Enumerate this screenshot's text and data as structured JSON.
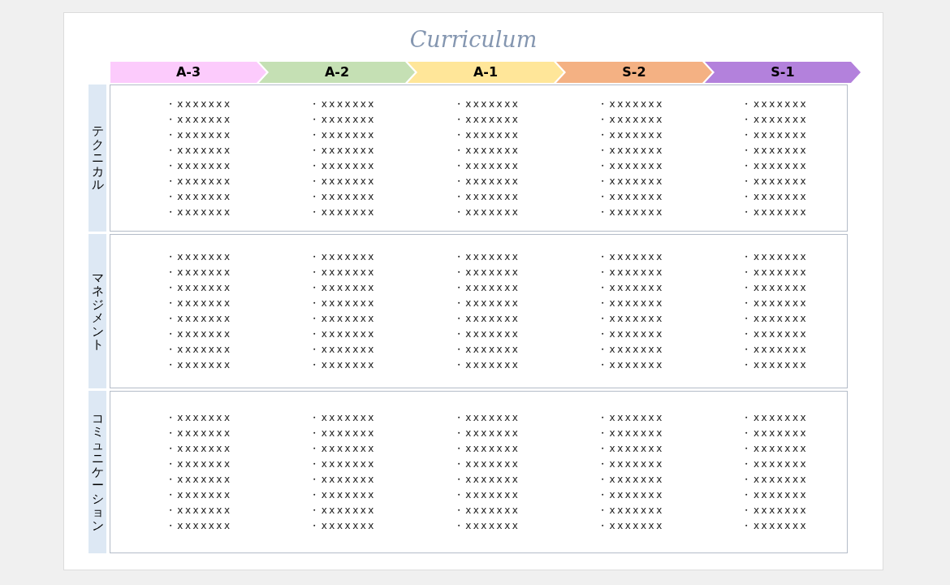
{
  "title": "Curriculum",
  "stages": [
    {
      "label": "A-3",
      "color": "#fccbfc"
    },
    {
      "label": "A-2",
      "color": "#c5e0b4"
    },
    {
      "label": "A-1",
      "color": "#ffe699"
    },
    {
      "label": "S-2",
      "color": "#f4b183"
    },
    {
      "label": "S-1",
      "color": "#b381dc"
    }
  ],
  "rows": [
    {
      "label": "テクニカル",
      "cells": [
        [
          "・xxxxxxx",
          "・xxxxxxx",
          "・xxxxxxx",
          "・xxxxxxx",
          "・xxxxxxx",
          "・xxxxxxx",
          "・xxxxxxx",
          "・xxxxxxx"
        ],
        [
          "・xxxxxxx",
          "・xxxxxxx",
          "・xxxxxxx",
          "・xxxxxxx",
          "・xxxxxxx",
          "・xxxxxxx",
          "・xxxxxxx",
          "・xxxxxxx"
        ],
        [
          "・xxxxxxx",
          "・xxxxxxx",
          "・xxxxxxx",
          "・xxxxxxx",
          "・xxxxxxx",
          "・xxxxxxx",
          "・xxxxxxx",
          "・xxxxxxx"
        ],
        [
          "・xxxxxxx",
          "・xxxxxxx",
          "・xxxxxxx",
          "・xxxxxxx",
          "・xxxxxxx",
          "・xxxxxxx",
          "・xxxxxxx",
          "・xxxxxxx"
        ],
        [
          "・xxxxxxx",
          "・xxxxxxx",
          "・xxxxxxx",
          "・xxxxxxx",
          "・xxxxxxx",
          "・xxxxxxx",
          "・xxxxxxx",
          "・xxxxxxx"
        ]
      ]
    },
    {
      "label": "マネジメント",
      "cells": [
        [
          "・xxxxxxx",
          "・xxxxxxx",
          "・xxxxxxx",
          "・xxxxxxx",
          "・xxxxxxx",
          "・xxxxxxx",
          "・xxxxxxx",
          "・xxxxxxx"
        ],
        [
          "・xxxxxxx",
          "・xxxxxxx",
          "・xxxxxxx",
          "・xxxxxxx",
          "・xxxxxxx",
          "・xxxxxxx",
          "・xxxxxxx",
          "・xxxxxxx"
        ],
        [
          "・xxxxxxx",
          "・xxxxxxx",
          "・xxxxxxx",
          "・xxxxxxx",
          "・xxxxxxx",
          "・xxxxxxx",
          "・xxxxxxx",
          "・xxxxxxx"
        ],
        [
          "・xxxxxxx",
          "・xxxxxxx",
          "・xxxxxxx",
          "・xxxxxxx",
          "・xxxxxxx",
          "・xxxxxxx",
          "・xxxxxxx",
          "・xxxxxxx"
        ],
        [
          "・xxxxxxx",
          "・xxxxxxx",
          "・xxxxxxx",
          "・xxxxxxx",
          "・xxxxxxx",
          "・xxxxxxx",
          "・xxxxxxx",
          "・xxxxxxx"
        ]
      ]
    },
    {
      "label": "コミュニケーション",
      "cells": [
        [
          "・xxxxxxx",
          "・xxxxxxx",
          "・xxxxxxx",
          "・xxxxxxx",
          "・xxxxxxx",
          "・xxxxxxx",
          "・xxxxxxx",
          "・xxxxxxx"
        ],
        [
          "・xxxxxxx",
          "・xxxxxxx",
          "・xxxxxxx",
          "・xxxxxxx",
          "・xxxxxxx",
          "・xxxxxxx",
          "・xxxxxxx",
          "・xxxxxxx"
        ],
        [
          "・xxxxxxx",
          "・xxxxxxx",
          "・xxxxxxx",
          "・xxxxxxx",
          "・xxxxxxx",
          "・xxxxxxx",
          "・xxxxxxx",
          "・xxxxxxx"
        ],
        [
          "・xxxxxxx",
          "・xxxxxxx",
          "・xxxxxxx",
          "・xxxxxxx",
          "・xxxxxxx",
          "・xxxxxxx",
          "・xxxxxxx",
          "・xxxxxxx"
        ],
        [
          "・xxxxxxx",
          "・xxxxxxx",
          "・xxxxxxx",
          "・xxxxxxx",
          "・xxxxxxx",
          "・xxxxxxx",
          "・xxxxxxx",
          "・xxxxxxx"
        ]
      ]
    }
  ]
}
